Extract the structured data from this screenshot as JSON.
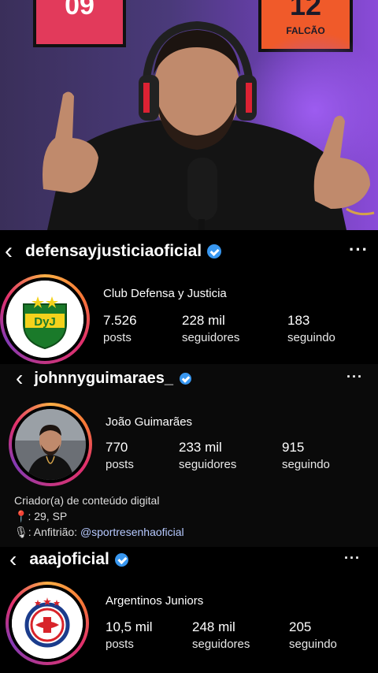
{
  "video": {
    "jersey_left": "09",
    "jersey_right_number": "12",
    "jersey_right_name": "FALCÃO"
  },
  "profiles": [
    {
      "handle": "defensayjusticiaoficial",
      "name": "Club Defensa y Justicia",
      "posts_value": "7.526",
      "posts_label": "posts",
      "followers_value": "228 mil",
      "followers_label": "seguidores",
      "following_value": "183",
      "following_label": "seguindo",
      "avatar_text": "DyJ"
    },
    {
      "handle": "johnnyguimaraes_",
      "name": "João Guimarães",
      "posts_value": "770",
      "posts_label": "posts",
      "followers_value": "233 mil",
      "followers_label": "seguidores",
      "following_value": "915",
      "following_label": "seguindo",
      "bio_line1": "Criador(a) de conteúdo digital",
      "bio_line2": ": 29, SP",
      "bio_line3_prefix": ": Anfitrião: ",
      "bio_line3_link": "@sportresenhaoficial"
    },
    {
      "handle": "aaajoficial",
      "name": "Argentinos Juniors",
      "posts_value": "10,5 mil",
      "posts_label": "posts",
      "followers_value": "248 mil",
      "followers_label": "seguidores",
      "following_value": "205",
      "following_label": "seguindo"
    }
  ],
  "icons": {
    "back": "‹",
    "more": "···",
    "pin": "📍",
    "mic": "🎙"
  }
}
